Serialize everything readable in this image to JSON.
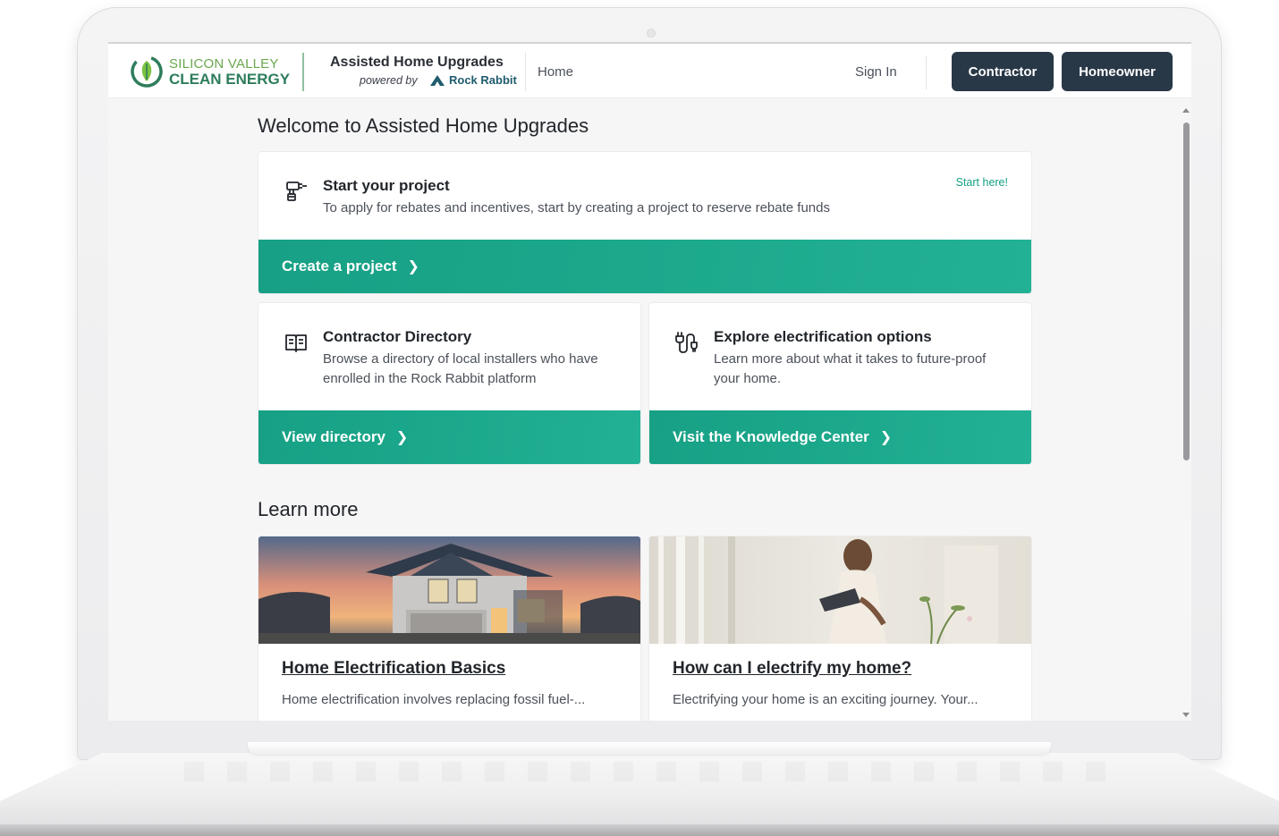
{
  "brand": {
    "logo_line1": "SILICON VALLEY",
    "logo_line2": "CLEAN ENERGY",
    "app_title": "Assisted Home Upgrades",
    "powered_by": "powered by",
    "partner": "Rock Rabbit"
  },
  "nav": {
    "home": "Home",
    "sign_in": "Sign In",
    "contractor": "Contractor",
    "homeowner": "Homeowner"
  },
  "page": {
    "welcome_title": "Welcome to Assisted Home Upgrades",
    "learn_more_title": "Learn more"
  },
  "start_card": {
    "icon": "drill-icon",
    "title": "Start your project",
    "description": "To apply for rebates and incentives, start by creating a project to reserve rebate funds",
    "start_here": "Start here!",
    "cta": "Create a project"
  },
  "directory_card": {
    "icon": "book-icon",
    "title": "Contractor Directory",
    "description": "Browse a directory of local installers who have enrolled in the Rock Rabbit platform",
    "cta": "View directory"
  },
  "electrification_card": {
    "icon": "plug-icon",
    "title": "Explore electrification options",
    "description": "Learn more about what it takes to future-proof your home.",
    "cta": "Visit the Knowledge Center"
  },
  "articles": [
    {
      "image": "house-at-sunset-image",
      "title": "Home Electrification Basics",
      "excerpt": "Home electrification involves replacing fossil fuel-..."
    },
    {
      "image": "woman-with-tablet-image",
      "title": "How can I electrify my home?",
      "excerpt": "Electrifying your home is an exciting journey. Your..."
    }
  ],
  "colors": {
    "accent_green": "#17a085",
    "nav_button": "#283847",
    "logo_green": "#2e7d5b"
  }
}
